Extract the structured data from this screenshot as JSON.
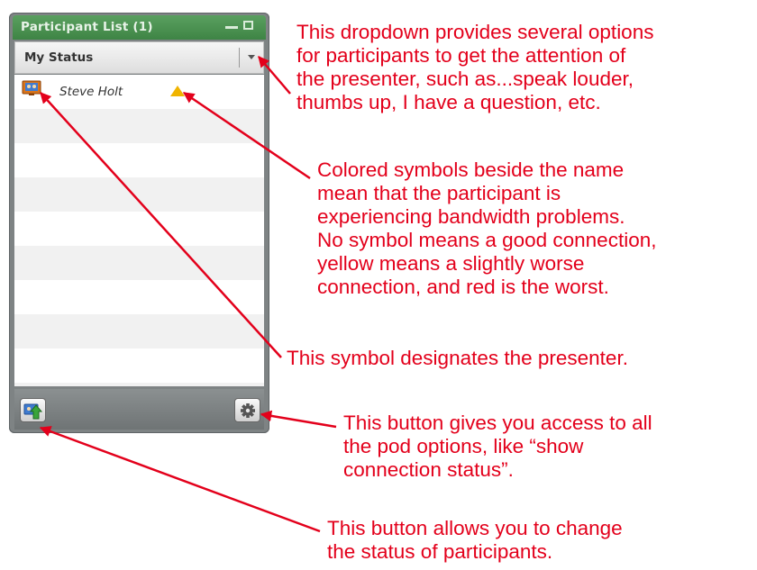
{
  "pod": {
    "title": "Participant List (1)",
    "status_label": "My Status",
    "participants": [
      {
        "name": "Steve Holt",
        "role": "presenter",
        "connection": "yellow"
      }
    ],
    "footer": {
      "left_button_icon": "change-status-icon",
      "right_button_icon": "gear-icon"
    }
  },
  "annotations": {
    "dropdown": [
      "This dropdown provides several options",
      "for participants to get the attention of",
      "the presenter, such as...speak louder,",
      "thumbs up,  I have a question, etc."
    ],
    "bandwidth": [
      "Colored symbols beside the name",
      "mean that the participant is",
      "experiencing bandwidth problems.",
      "No symbol means a good connection,",
      "yellow means a slightly worse",
      "connection, and red is the worst."
    ],
    "presenter": [
      "This symbol designates the presenter."
    ],
    "options": [
      "This button gives you access to all",
      "the pod options, like “show",
      "connection status”."
    ],
    "status": [
      "This button allows you to change",
      "the status of participants."
    ]
  },
  "colors": {
    "annotation": "#e3001b",
    "header_green": "#4a9150",
    "warning_yellow": "#f0b400"
  }
}
